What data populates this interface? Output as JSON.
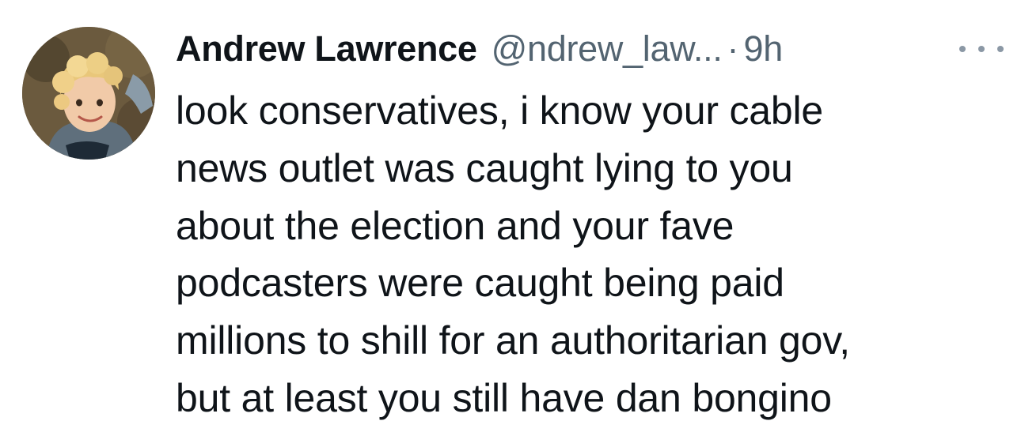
{
  "tweet": {
    "author_name": "Andrew Lawrence",
    "handle": "@ndrew_law...",
    "separator": "·",
    "time": "9h",
    "avatar_icon": "child-portrait-avatar",
    "more_icon": "more-options-icon",
    "text_lines": [
      "look conservatives, i know your cable",
      "news outlet was caught lying to you",
      "about the election and your fave",
      "podcasters were caught being paid",
      "millions to shill for an authoritarian gov,",
      "but at least you still have dan bongino"
    ]
  },
  "colors": {
    "text_primary": "#0f1419",
    "text_secondary": "#536471",
    "background": "#ffffff"
  }
}
